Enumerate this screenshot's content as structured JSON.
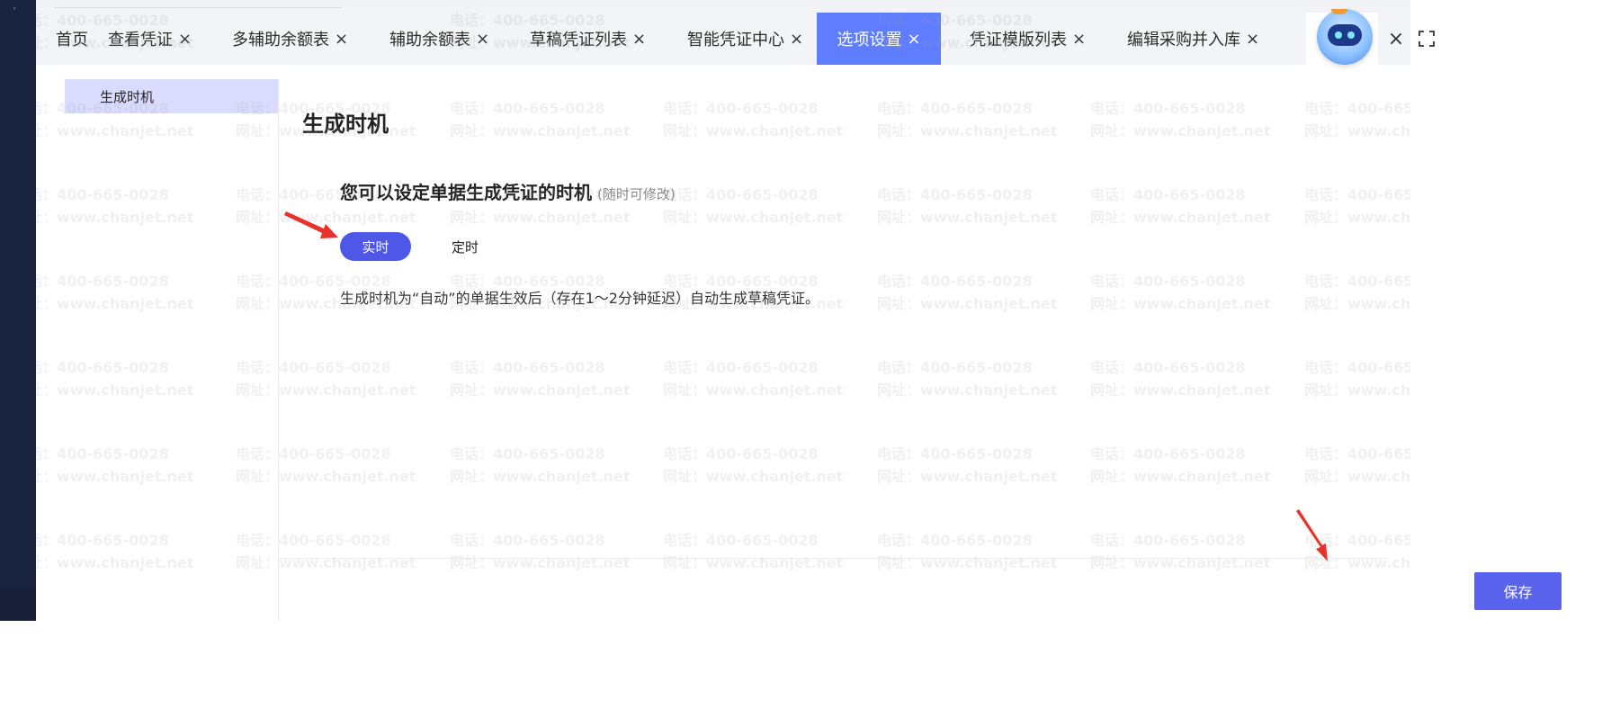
{
  "tabs": [
    {
      "label": "首页",
      "closable": false
    },
    {
      "label": "查看凭证",
      "closable": true
    },
    {
      "label": "多辅助余额表",
      "closable": true
    },
    {
      "label": "辅助余额表",
      "closable": true
    },
    {
      "label": "草稿凭证列表",
      "closable": true
    },
    {
      "label": "智能凭证中心",
      "closable": true
    },
    {
      "label": "选项设置",
      "closable": true,
      "active": true
    },
    {
      "label": "凭证模版列表",
      "closable": true
    },
    {
      "label": "编辑采购并入库",
      "closable": true
    }
  ],
  "tab_close_glyph": "×",
  "sidebar": {
    "items": [
      {
        "label": "生成时机",
        "active": true
      }
    ]
  },
  "main": {
    "title": "生成时机",
    "question": "您可以设定单据生成凭证的时机",
    "question_hint": "(随时可修改)",
    "options": [
      {
        "label": "实时",
        "selected": true
      },
      {
        "label": "定时",
        "selected": false
      }
    ],
    "description": "生成时机为“自动”的单据生效后（存在1～2分钟延迟）自动生成草稿凭证。"
  },
  "footer": {
    "save_label": "保存"
  },
  "watermark": {
    "phone": "电话：400-665-0028",
    "site": "网址：www.chanjet.net"
  },
  "icons": {
    "close_all": "close-icon",
    "fullscreen": "fullscreen-icon",
    "assistant": "robot-assistant-icon"
  },
  "colors": {
    "active_tab": "#5f7dff",
    "primary_button": "#5a63ee",
    "selected_option": "#4f57e8",
    "sidebar_active": "#d9dcff",
    "left_rail": "#1b2541",
    "annotation_arrow": "#e8322b"
  }
}
